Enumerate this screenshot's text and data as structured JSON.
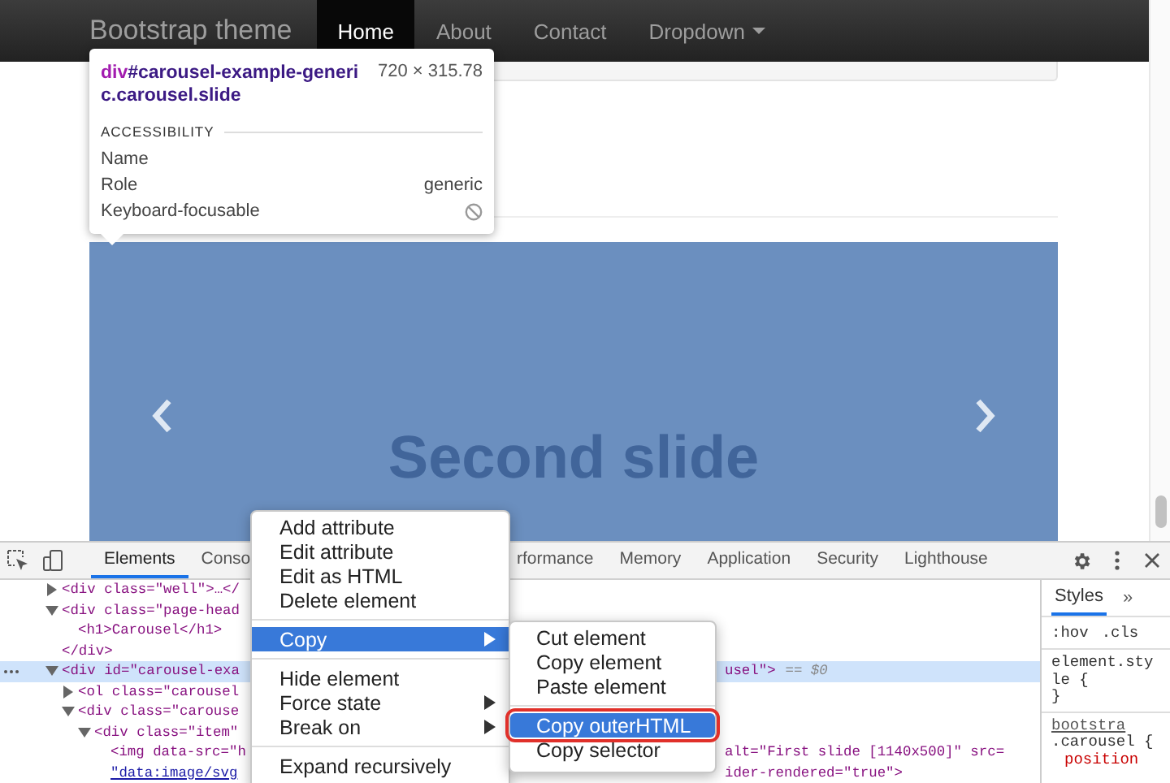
{
  "navbar": {
    "brand": "Bootstrap theme",
    "items": [
      {
        "label": "Home",
        "selected": true,
        "kind": "link"
      },
      {
        "label": "About",
        "selected": false,
        "kind": "link"
      },
      {
        "label": "Contact",
        "selected": false,
        "kind": "link"
      },
      {
        "label": "Dropdown",
        "selected": false,
        "kind": "dropdown"
      }
    ]
  },
  "tooltip": {
    "tag": "div",
    "selector": "#carousel-example-generic.carousel.slide",
    "size": "720 × 315.78",
    "section": "ACCESSIBILITY",
    "rows": [
      {
        "label": "Name",
        "kind": "empty"
      },
      {
        "label": "Role",
        "kind": "text",
        "value": "generic"
      },
      {
        "label": "Keyboard-focusable",
        "kind": "no"
      }
    ]
  },
  "carousel": {
    "caption": "Second slide"
  },
  "devtools": {
    "tabs_left": [
      {
        "label": "Elements",
        "selected": true
      },
      {
        "label": "Conso",
        "selected": false
      }
    ],
    "tabs_right": [
      {
        "label": "rformance",
        "selected": false
      },
      {
        "label": "Memory",
        "selected": false
      },
      {
        "label": "Application",
        "selected": false
      },
      {
        "label": "Security",
        "selected": false
      },
      {
        "label": "Lighthouse",
        "selected": false
      }
    ],
    "dom": [
      {
        "kind": "element",
        "text": "<div class=\"well\">…</",
        "expanded": false,
        "selected": false
      },
      {
        "kind": "element",
        "text": "<div class=\"page-head",
        "expanded": true,
        "selected": false,
        "children": [
          {
            "kind": "line",
            "text": "<h1>Carousel</h1>",
            "selected": false
          }
        ]
      },
      {
        "kind": "line",
        "text": "</div>",
        "selected": false
      },
      {
        "kind": "element",
        "text": "<div id=\"carousel-exa",
        "tail": "usel\">",
        "marker": "== $0",
        "expanded": true,
        "selected": true,
        "children": [
          {
            "kind": "element",
            "text": "<ol class=\"carousel",
            "expanded": false,
            "selected": false
          },
          {
            "kind": "element",
            "text": "<div class=\"carouse",
            "expanded": true,
            "selected": false,
            "children": [
              {
                "kind": "element",
                "text": "<div class=\"item\"",
                "expanded": true,
                "selected": false,
                "children": [
                  {
                    "kind": "line",
                    "text": "<img data-src=\"h",
                    "tail": "alt=\"First slide [1140x500]\" src=",
                    "selected": false
                  },
                  {
                    "kind": "link",
                    "text": "\"data:image/svg",
                    "tail": "ider-rendered=\"true\">",
                    "selected": false
                  }
                ]
              }
            ]
          }
        ]
      }
    ],
    "styles": {
      "tab": "Styles",
      "more": "»",
      "filters": [
        ":hov",
        ".cls"
      ],
      "rules": [
        {
          "kind": "rule",
          "text": "element.style {"
        },
        {
          "kind": "rule",
          "text": "}"
        },
        {
          "kind": "source",
          "text": "bootstra"
        },
        {
          "kind": "rule",
          "text": ".carousel {"
        },
        {
          "kind": "prop",
          "text": "position"
        }
      ]
    }
  },
  "context_menu": {
    "items": [
      {
        "kind": "item",
        "label": "Add attribute",
        "selected": false,
        "has_submenu": false
      },
      {
        "kind": "item",
        "label": "Edit attribute",
        "selected": false,
        "has_submenu": false
      },
      {
        "kind": "item",
        "label": "Edit as HTML",
        "selected": false,
        "has_submenu": false
      },
      {
        "kind": "item",
        "label": "Delete element",
        "selected": false,
        "has_submenu": false
      },
      {
        "kind": "separator"
      },
      {
        "kind": "item",
        "label": "Copy",
        "selected": true,
        "has_submenu": true
      },
      {
        "kind": "separator"
      },
      {
        "kind": "item",
        "label": "Hide element",
        "selected": false,
        "has_submenu": false
      },
      {
        "kind": "item",
        "label": "Force state",
        "selected": false,
        "has_submenu": true
      },
      {
        "kind": "item",
        "label": "Break on",
        "selected": false,
        "has_submenu": true
      },
      {
        "kind": "separator"
      },
      {
        "kind": "item",
        "label": "Expand recursively",
        "selected": false,
        "has_submenu": false
      }
    ]
  },
  "submenu": {
    "items": [
      {
        "kind": "item",
        "label": "Cut element",
        "selected": false,
        "outlined": false
      },
      {
        "kind": "item",
        "label": "Copy element",
        "selected": false,
        "outlined": false
      },
      {
        "kind": "item",
        "label": "Paste element",
        "selected": false,
        "outlined": false
      },
      {
        "kind": "separator"
      },
      {
        "kind": "item",
        "label": "Copy outerHTML",
        "selected": true,
        "outlined": true
      },
      {
        "kind": "item",
        "label": "Copy selector",
        "selected": false,
        "outlined": false
      }
    ]
  }
}
